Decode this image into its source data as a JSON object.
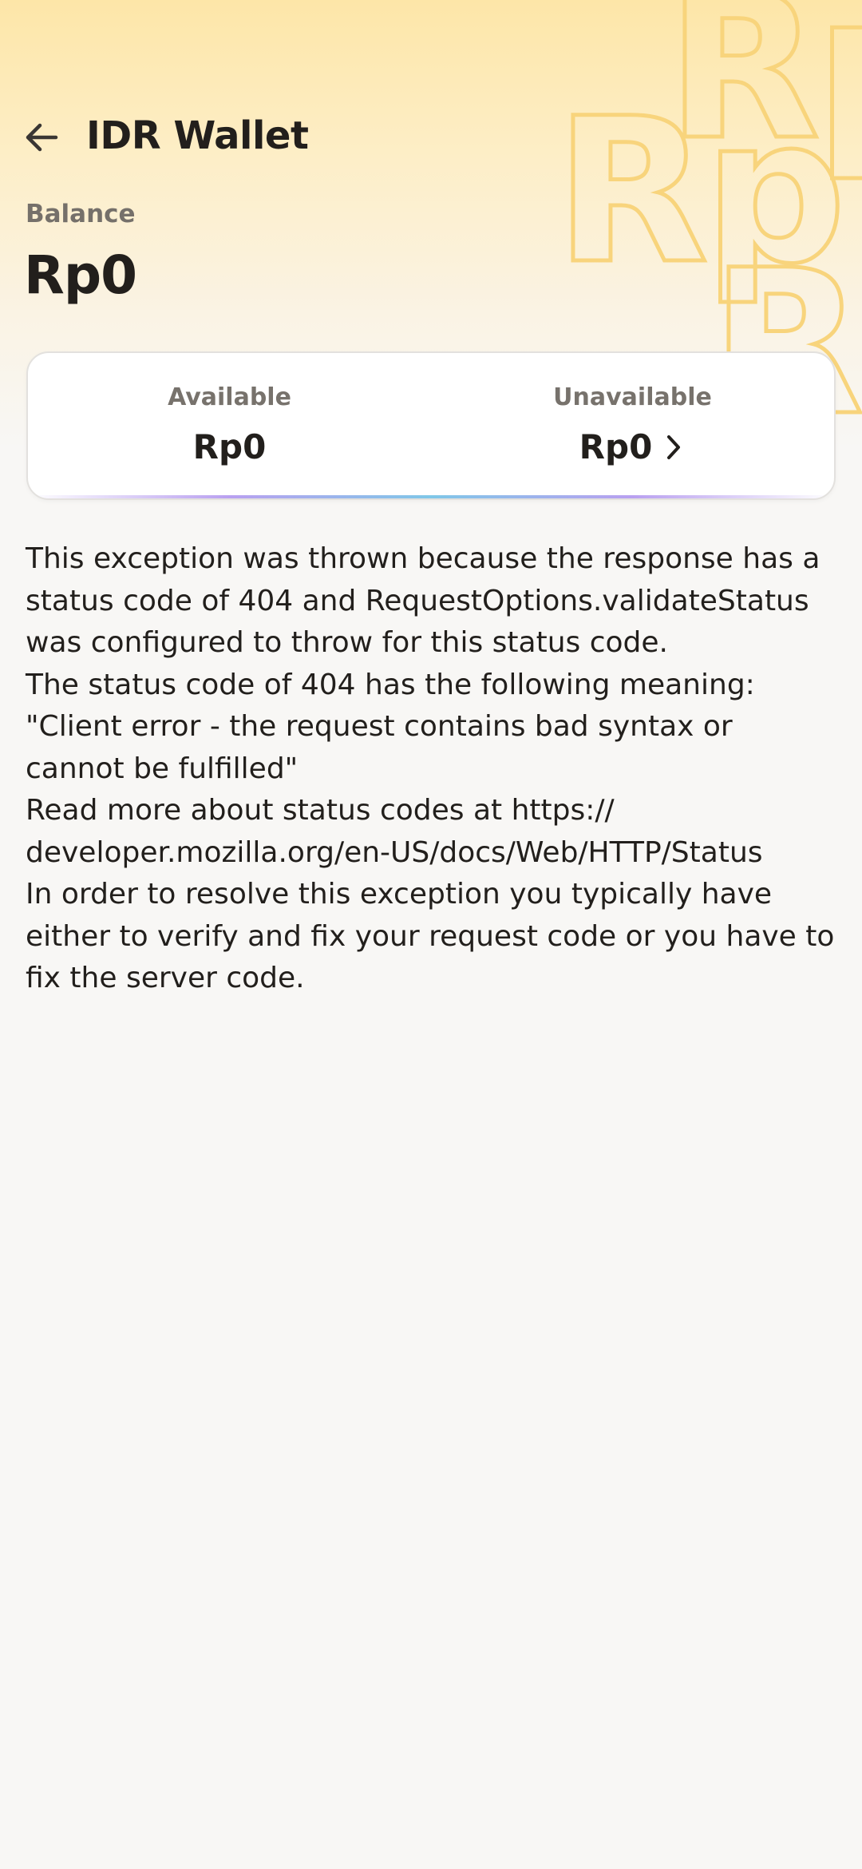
{
  "header": {
    "title": "IDR Wallet",
    "back_icon": "arrow-left-icon",
    "decoration_text": "Rp",
    "background_colors": [
      "#fde6a8",
      "#f8f7f5"
    ]
  },
  "balance": {
    "label": "Balance",
    "amount": "Rp0"
  },
  "breakdown": {
    "available_label": "Available",
    "available_value": "Rp0",
    "unavailable_label": "Unavailable",
    "unavailable_value": "Rp0",
    "chevron_icon": "chevron-right-icon"
  },
  "error": {
    "lines": [
      "This exception was thrown because the response has a status code of 404 and RequestOptions.validateStatus was configured to throw for this status code.",
      "The status code of 404 has the following meaning: \"Client error - the request contains bad syntax or cannot be fulfilled\"",
      "Read more about status codes at https:// developer.mozilla.org/en-US/docs/Web/HTTP/Status",
      "In order to resolve this exception you typically have either to verify and fix your request code or you have to fix the server code."
    ]
  }
}
